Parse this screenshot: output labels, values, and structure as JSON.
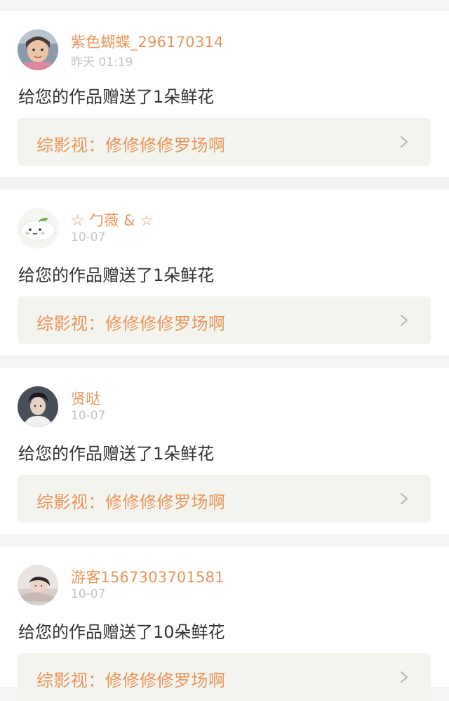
{
  "notifications": [
    {
      "username": "紫色蝴蝶_296170314",
      "time": "昨天 01:19",
      "message": "给您的作品赠送了1朵鲜花",
      "work_link": "综影视：修修修修罗场啊",
      "avatar_icon": "child-photo-avatar"
    },
    {
      "username": "☆ 勹薇 & ☆",
      "time": "10-07",
      "message": "给您的作品赠送了1朵鲜花",
      "work_link": "综影视：修修修修罗场啊",
      "avatar_icon": "cartoon-dumpling-avatar"
    },
    {
      "username": "贤哒",
      "time": "10-07",
      "message": "给您的作品赠送了1朵鲜花",
      "work_link": "综影视：修修修修罗场啊",
      "avatar_icon": "person-photo-avatar"
    },
    {
      "username": "游客1567303701581",
      "time": "10-07",
      "message": "给您的作品赠送了10朵鲜花",
      "work_link": "综影视：修修修修罗场啊",
      "avatar_icon": "reclining-person-avatar"
    }
  ],
  "colors": {
    "accent": "#e8955c",
    "time": "#c4c4c4",
    "link_bg": "#f4f4ee",
    "page_bg": "#f4f4f4"
  }
}
